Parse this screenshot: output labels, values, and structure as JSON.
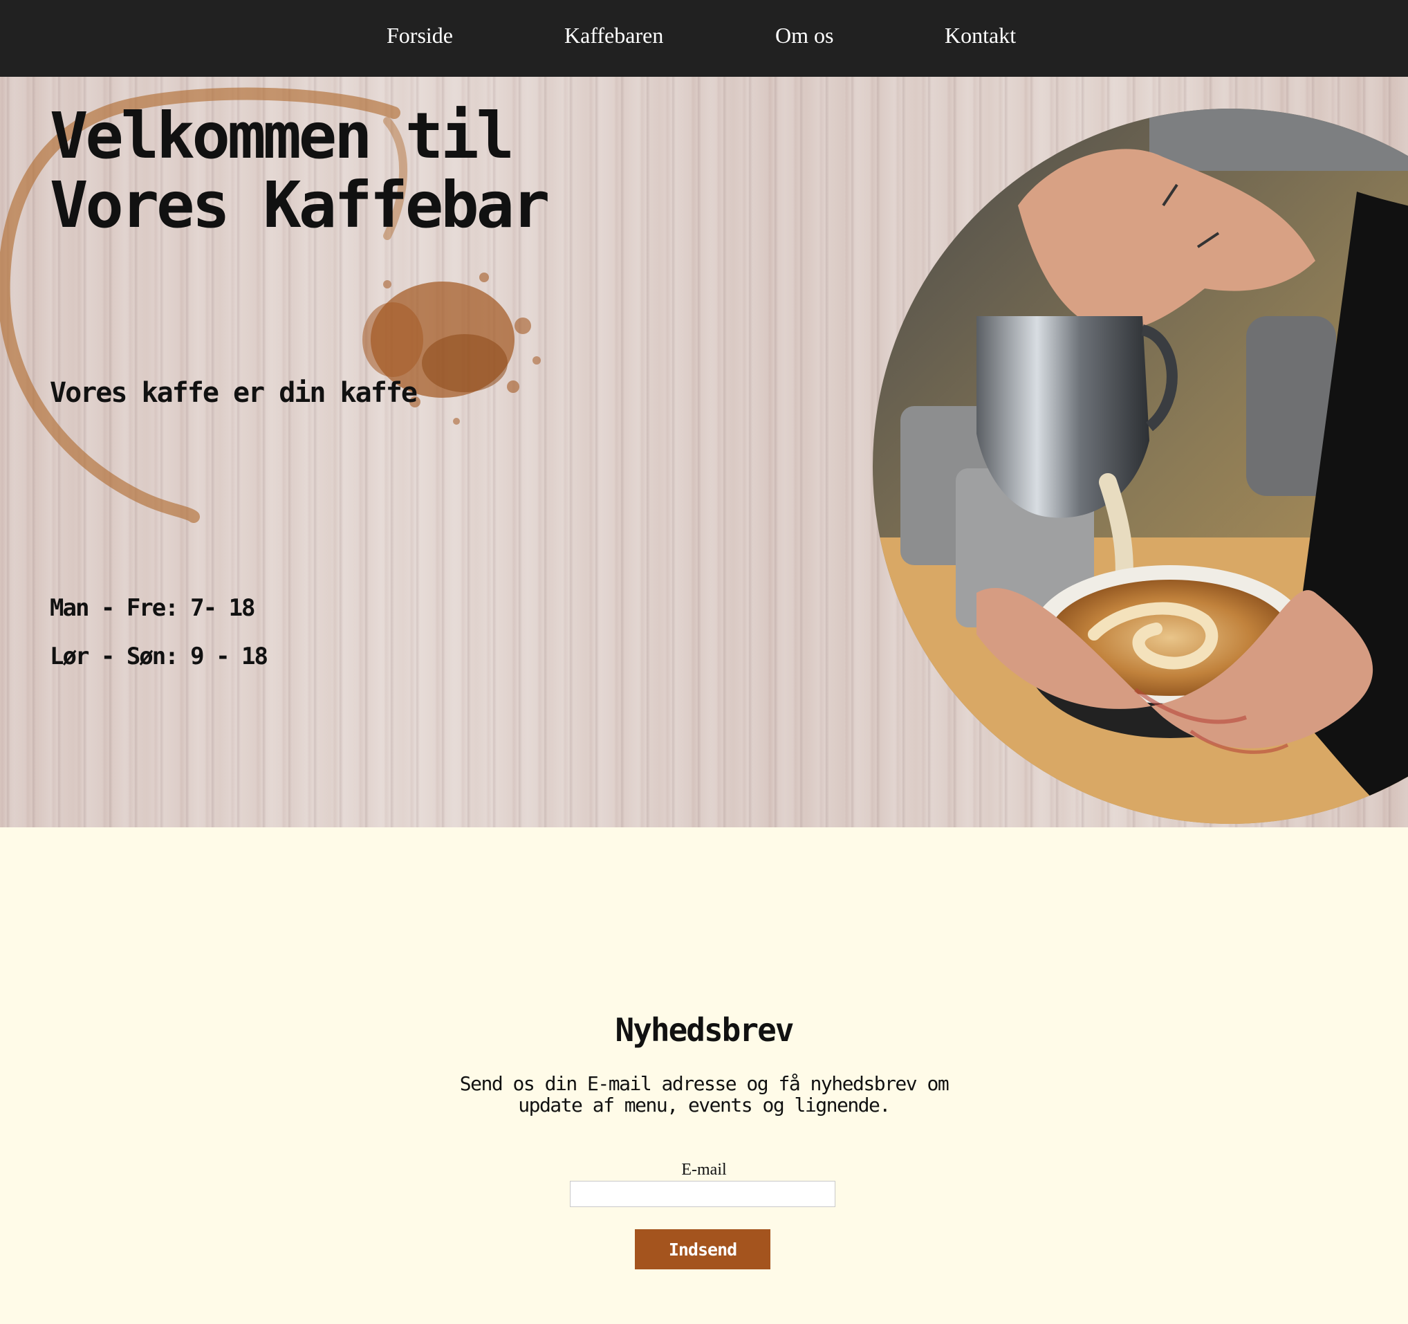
{
  "nav": {
    "items": [
      {
        "label": "Forside"
      },
      {
        "label": "Kaffebaren"
      },
      {
        "label": "Om os"
      },
      {
        "label": "Kontakt"
      }
    ]
  },
  "hero": {
    "title_line1": "Velkommen til",
    "title_line2": "Vores Kaffebar",
    "tagline": "Vores kaffe er din kaffe",
    "hours": [
      "Man - Fre: 7- 18",
      "Lør - Søn: 9 - 18"
    ],
    "photo_icon": "latte-art-photo"
  },
  "newsletter": {
    "title": "Nyhedsbrev",
    "description": "Send os din E-mail adresse og få nyhedsbrev om update af menu, events og lignende.",
    "email_label": "E-mail",
    "email_value": "",
    "submit_label": "Indsend"
  },
  "colors": {
    "nav_background": "#212121",
    "page_background": "#fffbe8",
    "accent": "#a4541e",
    "divider": "#a44f12"
  }
}
